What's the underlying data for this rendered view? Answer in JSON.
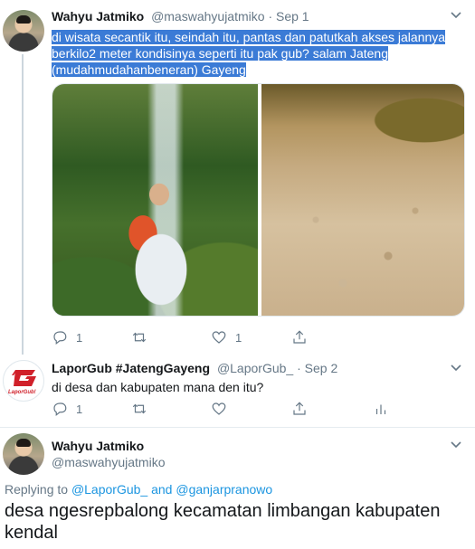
{
  "tweet1": {
    "name": "Wahyu Jatmiko",
    "handle": "@maswahyujatmiko",
    "sep": "·",
    "date": "Sep 1",
    "text_line1": "di wisata secantik itu, seindah itu, pantas dan patutkah akses jalannya",
    "text_line2": "berkilo2 meter kondisinya seperti itu pak gub?  salam Jateng",
    "text_line3": "(mudahmudahanbeneran) Gayeng",
    "reply_count": "1",
    "retweet_count": "",
    "like_count": "1"
  },
  "tweet2": {
    "name": "LaporGub #JatengGayeng",
    "handle": "@LaporGub_",
    "sep": "·",
    "date": "Sep 2",
    "text": "di desa dan kabupaten mana den itu?",
    "reply_count": "1",
    "logo_text": "LaporGub!"
  },
  "tweet3": {
    "name": "Wahyu Jatmiko",
    "handle": "@maswahyujatmiko",
    "replying_prefix": "Replying to",
    "replying_to_1": "@LaporGub_",
    "replying_and": "and",
    "replying_to_2": "@ganjarpranowo",
    "text": "desa ngesrepbalong kecamatan limbangan kabupaten kendal"
  },
  "colors": {
    "accent": "#1da1f2",
    "link": "#1b95e0",
    "muted": "#657786",
    "highlight": "#3b7bd6",
    "lapor_red": "#d0202a"
  },
  "icons": [
    "chevron-down-icon",
    "reply-icon",
    "retweet-icon",
    "like-icon",
    "share-icon",
    "analytics-icon"
  ]
}
